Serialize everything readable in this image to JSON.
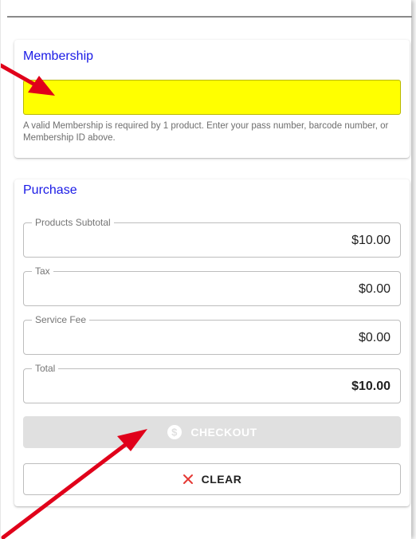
{
  "membership": {
    "title": "Membership",
    "input_value": "",
    "input_placeholder": "",
    "helper_text": "A valid Membership is required by 1 product. Enter your pass number, barcode number, or Membership ID above.",
    "highlight_color": "#ffff00"
  },
  "purchase": {
    "title": "Purchase",
    "fields": [
      {
        "label": "Products Subtotal",
        "value": "$10.00"
      },
      {
        "label": "Tax",
        "value": "$0.00"
      },
      {
        "label": "Service Fee",
        "value": "$0.00"
      },
      {
        "label": "Total",
        "value": "$10.00"
      }
    ],
    "checkout_label": "CHECKOUT",
    "checkout_icon": "dollar-circle-icon",
    "checkout_disabled": true,
    "clear_label": "CLEAR",
    "clear_icon": "close-x-icon"
  },
  "colors": {
    "title_blue": "#1a1ae6",
    "annotation_arrow": "#e0001a",
    "clear_icon": "#e53935"
  }
}
